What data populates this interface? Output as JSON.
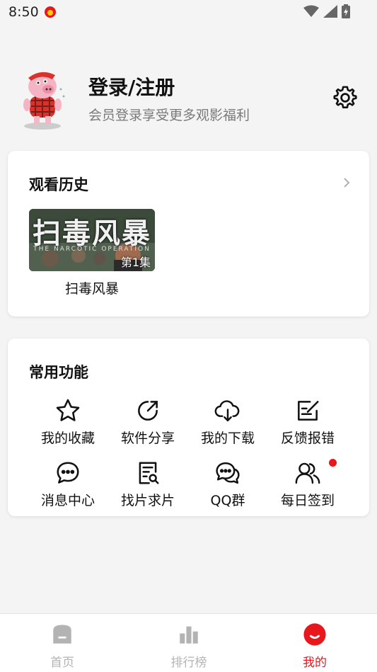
{
  "status_bar": {
    "time": "8:50"
  },
  "profile": {
    "title": "登录/注册",
    "subtitle": "会员登录享受更多观影福利"
  },
  "history": {
    "title": "观看历史",
    "items": [
      {
        "name": "扫毒风暴",
        "poster_title": "扫毒风暴",
        "poster_subtitle": "THE NARCOTIC OPERATION",
        "episode": "第1集"
      }
    ]
  },
  "features": {
    "title": "常用功能",
    "items": [
      {
        "label": "我的收藏",
        "icon": "star-icon"
      },
      {
        "label": "软件分享",
        "icon": "share-icon"
      },
      {
        "label": "我的下载",
        "icon": "cloud-download-icon"
      },
      {
        "label": "反馈报错",
        "icon": "feedback-edit-icon"
      },
      {
        "label": "消息中心",
        "icon": "chat-bubble-icon"
      },
      {
        "label": "找片求片",
        "icon": "document-search-icon"
      },
      {
        "label": "QQ群",
        "icon": "chat-bubbles-icon"
      },
      {
        "label": "每日签到",
        "icon": "users-icon"
      }
    ]
  },
  "bottom_nav": {
    "items": [
      {
        "label": "首页",
        "icon": "home-icon"
      },
      {
        "label": "排行榜",
        "icon": "bar-chart-icon"
      },
      {
        "label": "我的",
        "icon": "smile-icon",
        "active": true
      }
    ]
  },
  "colors": {
    "accent": "#e8161d",
    "inactive": "#b3b3b3"
  }
}
